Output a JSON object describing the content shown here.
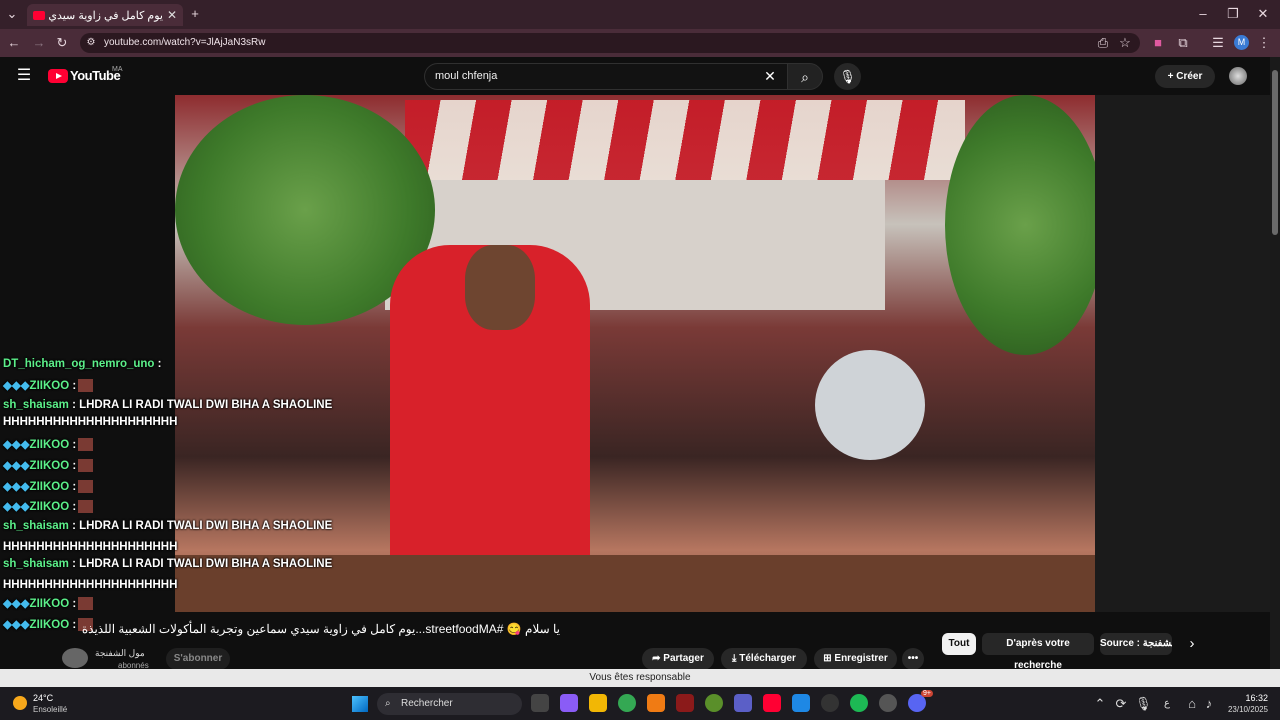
{
  "browser": {
    "tab_title": "يوم كامل في زاوية سيدي س...",
    "url": "youtube.com/watch?v=JlAjJaN3sRw",
    "profile_initial": "M"
  },
  "youtube": {
    "logo_text": "YouTube",
    "region": "MA",
    "search_query": "moul chfenja",
    "create_label": "Créer"
  },
  "chat": [
    {
      "name": "DT_hicham_og_nemro_uno",
      "badges": "",
      "message": ":"
    },
    {
      "name": "ZIIKOO",
      "badges": "◆◆◆",
      "message": ":"
    },
    {
      "name": "sh_shaisam",
      "badges": "",
      "message": ": LHDRA LI RADI TWALI DWI BIHA A SHAOLINE"
    },
    {
      "name": "",
      "badges": "",
      "message": "HHHHHHHHHHHHHHHHHHHHH"
    },
    {
      "name": "ZIIKOO",
      "badges": "◆◆◆",
      "message": ":"
    },
    {
      "name": "ZIIKOO",
      "badges": "◆◆◆",
      "message": ":"
    },
    {
      "name": "ZIIKOO",
      "badges": "◆◆◆",
      "message": ":"
    },
    {
      "name": "ZIIKOO",
      "badges": "◆◆◆",
      "message": ":"
    },
    {
      "name": "sh_shaisam",
      "badges": "",
      "message": ": LHDRA LI RADI TWALI DWI BIHA A SHAOLINE"
    },
    {
      "name": "",
      "badges": "",
      "message": "HHHHHHHHHHHHHHHHHHHHH"
    },
    {
      "name": "sh_shaisam",
      "badges": "",
      "message": ": LHDRA LI RADI TWALI DWI BIHA A SHAOLINE"
    },
    {
      "name": "",
      "badges": "",
      "message": "HHHHHHHHHHHHHHHHHHHHH"
    },
    {
      "name": "ZIIKOO",
      "badges": "◆◆◆",
      "message": ":"
    },
    {
      "name": "ZIIKOO",
      "badges": "◆◆◆",
      "message": ":"
    }
  ],
  "video": {
    "title": "يا سلام 😋 #streetfoodMA...يوم كامل في زاوية سيدي سماعين وتجربة المأكولات الشعبية اللذيذة",
    "channel": "مول الشفنجة",
    "subscribers": "abonnés",
    "subscribe_label": "S'abonner",
    "actions": [
      "Partager",
      "Télécharger",
      "Enregistrer"
    ]
  },
  "chips": [
    "Tout",
    "D'après votre recherche",
    "Source : الشفنجة"
  ],
  "statusbar_text": "Vous êtes responsable",
  "taskbar": {
    "weather_temp": "24°C",
    "weather_desc": "Ensoleillé",
    "search_label": "Rechercher",
    "time": "16:32",
    "date": "23/10/2025",
    "notification_badge": "9+"
  },
  "colors": {
    "chrome_bg": "#35202a",
    "yt_red": "#ff0033",
    "chat_name": "#5cf08a"
  }
}
